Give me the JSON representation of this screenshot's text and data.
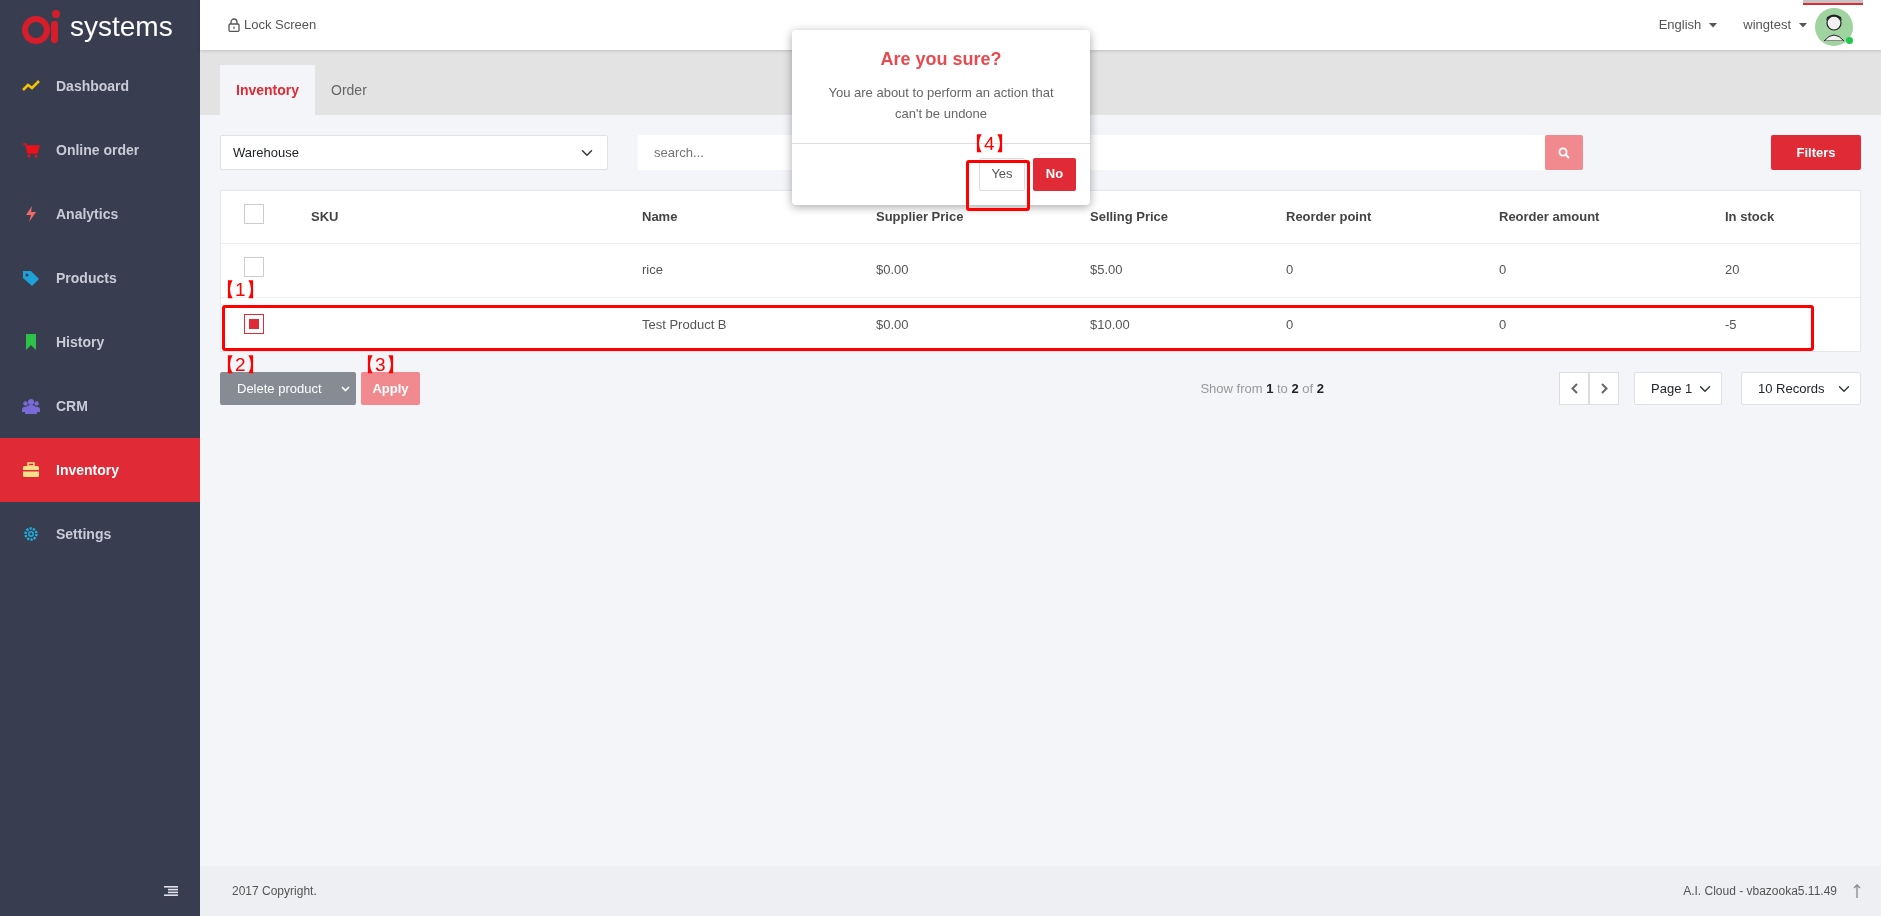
{
  "sidebar": {
    "logo_text": "systems",
    "items": [
      {
        "label": "Dashboard",
        "kind": "trend",
        "color": "#f5c400",
        "selected": false
      },
      {
        "label": "Online order",
        "kind": "cart",
        "color": "#e8121b",
        "selected": false
      },
      {
        "label": "Analytics",
        "kind": "bolt",
        "color": "#f06a6a",
        "selected": false
      },
      {
        "label": "Products",
        "kind": "tag",
        "color": "#1ea0d8",
        "selected": false
      },
      {
        "label": "History",
        "kind": "bookmark",
        "color": "#2ec24a",
        "selected": false
      },
      {
        "label": "CRM",
        "kind": "users",
        "color": "#7a6ad8",
        "selected": false
      },
      {
        "label": "Inventory",
        "kind": "briefcase",
        "color": "#f7e08a",
        "selected": true
      },
      {
        "label": "Settings",
        "kind": "gear",
        "color": "#1eb0e0",
        "selected": false
      }
    ]
  },
  "header": {
    "lock": "Lock Screen",
    "language": "English",
    "user": "wingtest",
    "online": true
  },
  "tabs": [
    {
      "label": "Inventory",
      "selected": true
    },
    {
      "label": "Order",
      "selected": false
    }
  ],
  "filters": {
    "warehouse": "Warehouse",
    "search": {
      "placeholder": "search..."
    },
    "button": "Filters"
  },
  "table": {
    "columns": [
      "SKU",
      "Name",
      "Supplier Price",
      "Selling Price",
      "Reorder point",
      "Reorder amount",
      "In stock"
    ],
    "header_checked": false,
    "rows": [
      {
        "checked": false,
        "cells": [
          "",
          "rice",
          "$0.00",
          "$5.00",
          "0",
          "0",
          "20"
        ]
      },
      {
        "checked": true,
        "cells": [
          "",
          "Test Product B",
          "$0.00",
          "$10.00",
          "0",
          "0",
          "-5"
        ]
      }
    ]
  },
  "bulk": {
    "action": "Delete product",
    "apply": "Apply"
  },
  "pagination": {
    "summary": "Show from **1** to **2** of **2**",
    "page": "Page 1",
    "records": "10 Records"
  },
  "dialog": {
    "title": "Are you sure?",
    "message": "You are about to perform an action that can't be undone",
    "confirm": "Yes",
    "cancel": "No"
  },
  "annotations": [
    {
      "label": "【1】",
      "framed": true
    },
    {
      "label": "【2】",
      "framed": false
    },
    {
      "label": "【3】",
      "framed": false
    },
    {
      "label": "【4】",
      "framed": true
    }
  ],
  "footer": {
    "copyright": "2017 Copyright.",
    "version": "A.I. Cloud - vbazooka5.11.49"
  }
}
